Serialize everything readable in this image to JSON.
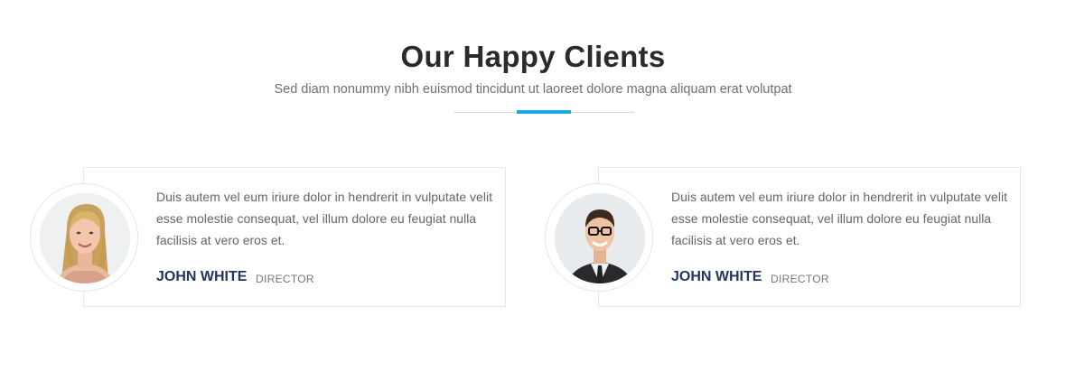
{
  "section": {
    "title": "Our Happy Clients",
    "subtitle": "Sed diam nonummy nibh euismod tincidunt ut laoreet dolore magna aliquam erat volutpat",
    "accent_color": "#1fa8de"
  },
  "testimonials": [
    {
      "quote": "Duis autem vel eum iriure dolor in hendrerit in vulputate velit esse molestie consequat, vel illum dolore eu feugiat nulla facilisis at vero eros et.",
      "name": "JOHN WHITE",
      "role": "DIRECTOR",
      "avatar_icon": "woman-portrait-icon"
    },
    {
      "quote": "Duis autem vel eum iriure dolor in hendrerit in vulputate velit esse molestie consequat, vel illum dolore eu feugiat nulla facilisis at vero eros et.",
      "name": "JOHN WHITE",
      "role": "DIRECTOR",
      "avatar_icon": "man-portrait-icon"
    }
  ],
  "colors": {
    "name": "#24365e",
    "text": "#666666",
    "border": "#e7e7e7"
  }
}
